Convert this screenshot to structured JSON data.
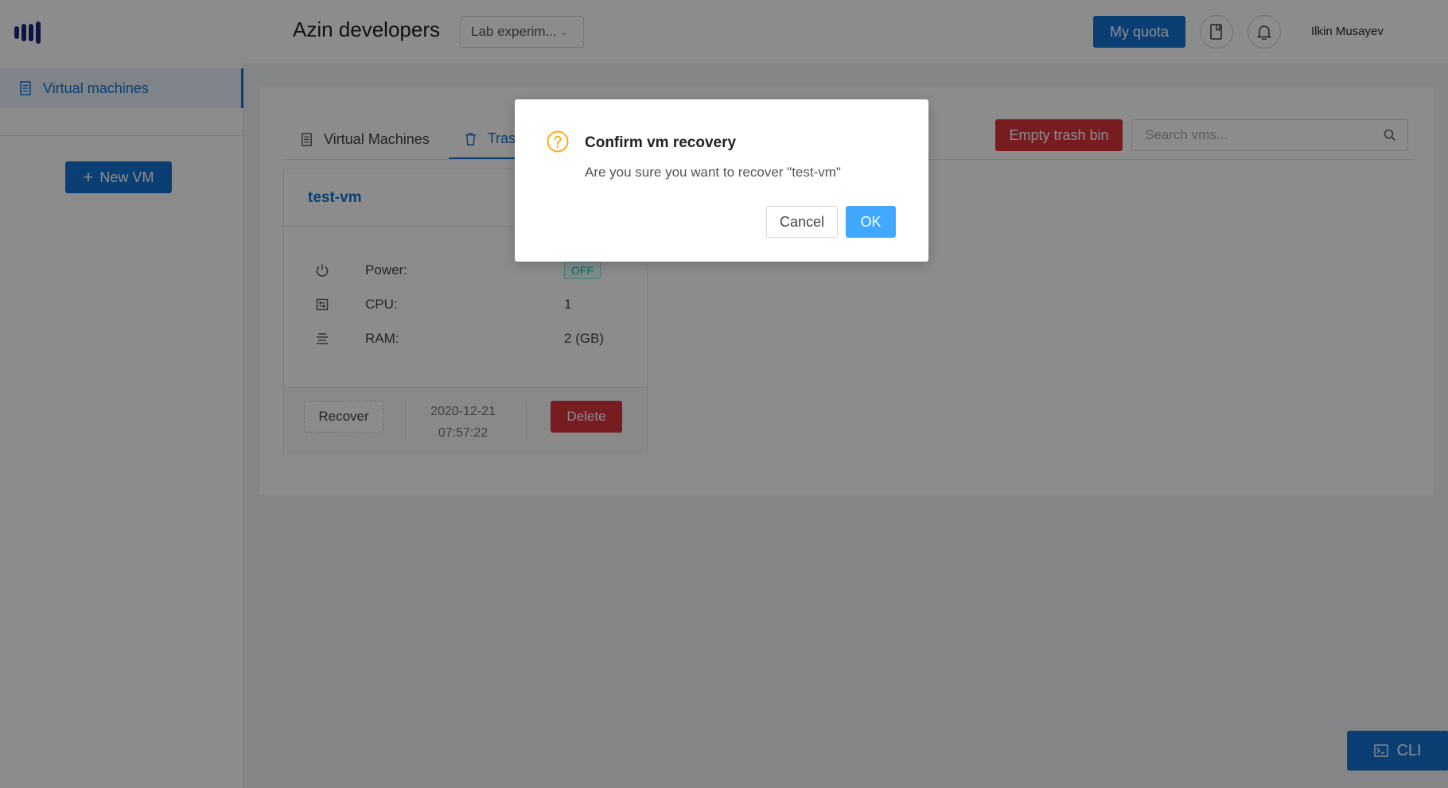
{
  "header": {
    "company_name": "Azin developers",
    "project_select": "Lab experim...",
    "quota_button": "My quota",
    "user_name": "Ilkin Musayev"
  },
  "sidebar": {
    "items": [
      {
        "label": "Virtual machines",
        "icon": "server-icon",
        "active": true
      }
    ],
    "new_vm_button": "New VM"
  },
  "main": {
    "tabs": [
      {
        "label": "Virtual Machines",
        "icon": "server-icon",
        "active": false
      },
      {
        "label": "Tras",
        "icon": "trash-icon",
        "active": true
      }
    ],
    "empty_trash_button": "Empty trash bin",
    "search_placeholder": "Search vms..."
  },
  "vm_card": {
    "name": "test-vm",
    "specs": {
      "power": {
        "label": "Power:",
        "value": "OFF",
        "icon": "power-icon"
      },
      "cpu": {
        "label": "CPU:",
        "value": "1",
        "icon": "cpu-icon"
      },
      "ram": {
        "label": "RAM:",
        "value": "2 (GB)",
        "icon": "ram-icon"
      }
    },
    "recover_button": "Recover",
    "deleted_date": "2020-12-21",
    "deleted_time": "07:57:22",
    "delete_button": "Delete"
  },
  "cli_button": "CLI",
  "modal": {
    "title": "Confirm vm recovery",
    "message": "Are you sure you want to recover \"test-vm\"",
    "cancel_button": "Cancel",
    "ok_button": "OK",
    "icon": "question-icon"
  },
  "colors": {
    "primary": "#1474d4",
    "danger": "#d9363e",
    "ok": "#40a9ff",
    "warning_icon": "#faad14",
    "off_tag": "#13c2c2"
  }
}
